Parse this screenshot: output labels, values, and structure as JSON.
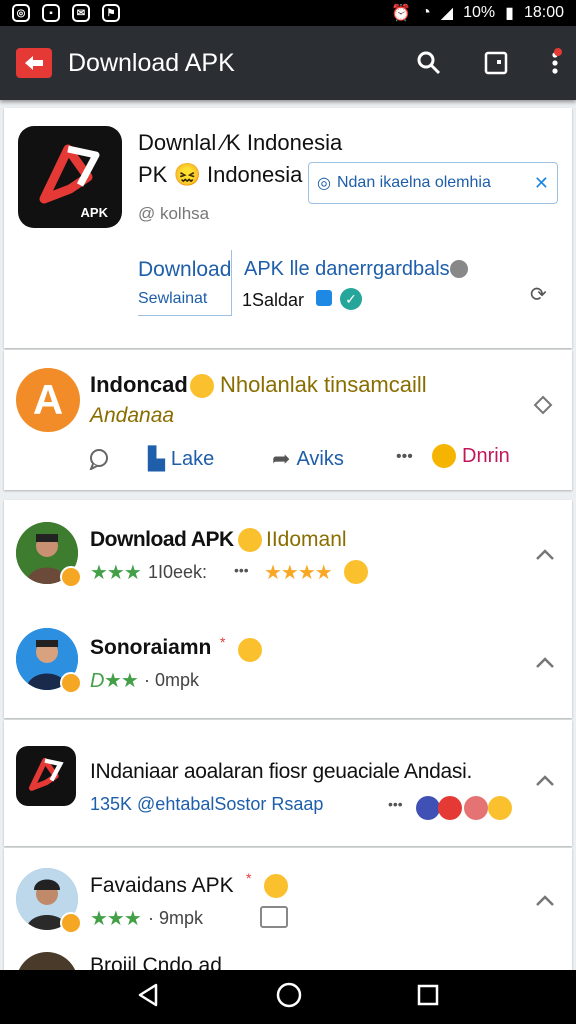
{
  "status_bar": {
    "time": "18:00",
    "battery": "10%"
  },
  "app_bar": {
    "title": "Download APK"
  },
  "app_card": {
    "title_line1": "Downlal ⁄K Indonesia",
    "title_line2": "PK 😖 Indonesia",
    "developer": "@ kolhsa",
    "badge_text": "Ndan ikaelna olemhia",
    "download_label": "Download",
    "download_sub": "Sewlainat",
    "info_line1": "APK lle danerrgardbals",
    "info_line2": "1Saldar",
    "logo_text": "APK"
  },
  "post_card": {
    "logo_letter": "A",
    "title": "Indoncad",
    "title_rest": "Nholanlak tinsamcaill",
    "subtitle": "Andanaa",
    "actions": {
      "like": "Lake",
      "share": "Aviks",
      "more": "•••",
      "react": "Dnrin"
    }
  },
  "reviews": [
    {
      "name": "Download APK",
      "name_rest": "IIdomanl",
      "stars": "★★★",
      "meta": "1I0eek:",
      "dots": "•••",
      "gold_stars": "★★★★"
    },
    {
      "name": "Sonoraiamn",
      "stars": "★★",
      "prefix": "D",
      "meta": "· 0mpk"
    }
  ],
  "app_row": {
    "title": "INdaniaar aoalaran fiosr geuaciale Andasi.",
    "meta": "135K @ehtabalSostor Rsaap",
    "dots": "•••"
  },
  "review3": {
    "name": "Favaidans APK",
    "stars": "★★★",
    "meta": "· 9mpk"
  },
  "partial_row": {
    "name": "Brojil Cndo ad"
  },
  "colors": {
    "accent_red": "#e53935",
    "appbar": "#2b2f33",
    "link_blue": "#1e5eaa",
    "star_green": "#43a047",
    "star_gold": "#f9a825"
  }
}
